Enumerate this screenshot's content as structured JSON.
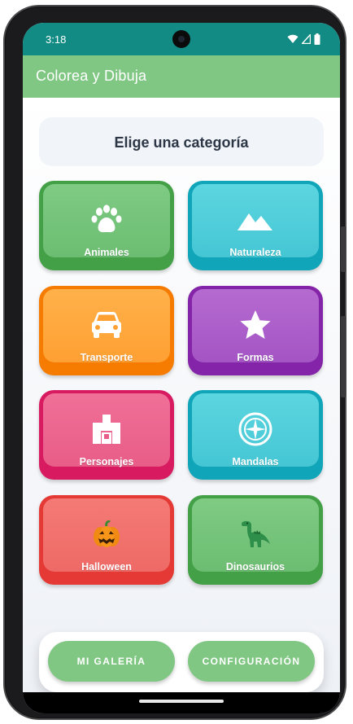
{
  "status": {
    "time": "3:18",
    "icons": [
      "wifi-icon",
      "signal-icon",
      "battery-icon"
    ]
  },
  "appbar": {
    "title": "Colorea y Dibuja",
    "color": "#81c784"
  },
  "section": {
    "title": "Elige una categoría"
  },
  "categories": [
    {
      "label": "Animales",
      "icon": "paw-icon",
      "color": "#7fcb84"
    },
    {
      "label": "Naturaleza",
      "icon": "mountain-icon",
      "color": "#5cd6e0"
    },
    {
      "label": "Transporte",
      "icon": "car-icon",
      "color": "#ffb14a"
    },
    {
      "label": "Formas",
      "icon": "star-icon",
      "color": "#b56ad0"
    },
    {
      "label": "Personajes",
      "icon": "character-icon",
      "color": "#f07098"
    },
    {
      "label": "Mandalas",
      "icon": "mandala-icon",
      "color": "#5cd6e0"
    },
    {
      "label": "Halloween",
      "icon": "pumpkin-icon",
      "color": "#f47a76"
    },
    {
      "label": "Dinosaurios",
      "icon": "dinosaur-icon",
      "color": "#7fcb84"
    }
  ],
  "actions": {
    "gallery_label": "MI GALERÍA",
    "settings_label": "CONFIGURACIÓN"
  }
}
